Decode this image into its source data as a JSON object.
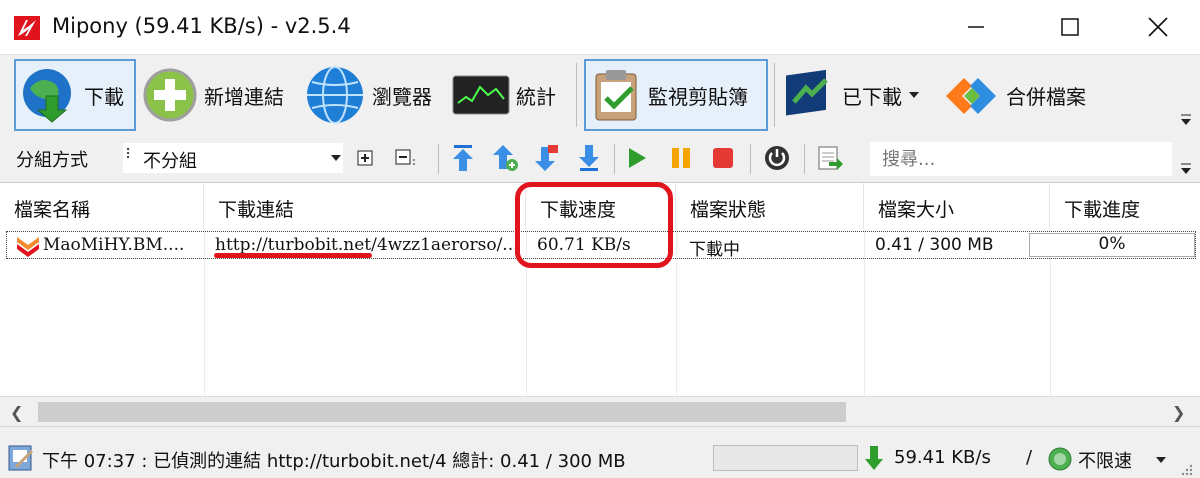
{
  "window": {
    "title": "Mipony (59.41 KB/s) - v2.5.4"
  },
  "toolbar": {
    "download": "下載",
    "add_link": "新增連結",
    "browser": "瀏覽器",
    "stats": "統計",
    "monitor_clipboard": "監視剪貼簿",
    "downloaded": "已下載",
    "merge_files": "合併檔案"
  },
  "toolbar2": {
    "group_label": "分組方式",
    "group_value": "不分組",
    "search_placeholder": "搜尋..."
  },
  "columns": [
    "檔案名稱",
    "下載連結",
    "下載速度",
    "檔案狀態",
    "檔案大小",
    "下載進度"
  ],
  "rows": [
    {
      "name": "MaoMiHY.BM....",
      "link": "http://turbobit.net/4wzz1aerorso/...",
      "speed": "60.71 KB/s",
      "status": "下載中",
      "size": "0.41 / 300 MB",
      "progress": "0%",
      "progress_fraction": 0.0
    }
  ],
  "statusbar": {
    "text": "下午 07:37 : 已偵測的連結 http://turbobit.net/4 總計: 0.41 / 300 MB",
    "speed": "59.41 KB/s",
    "slash": "/",
    "limit": "不限速"
  },
  "colors": {
    "highlight": "#e0141d",
    "toolbar_bg": "#f0f0f0",
    "pressed_border": "#5c9bd6"
  }
}
